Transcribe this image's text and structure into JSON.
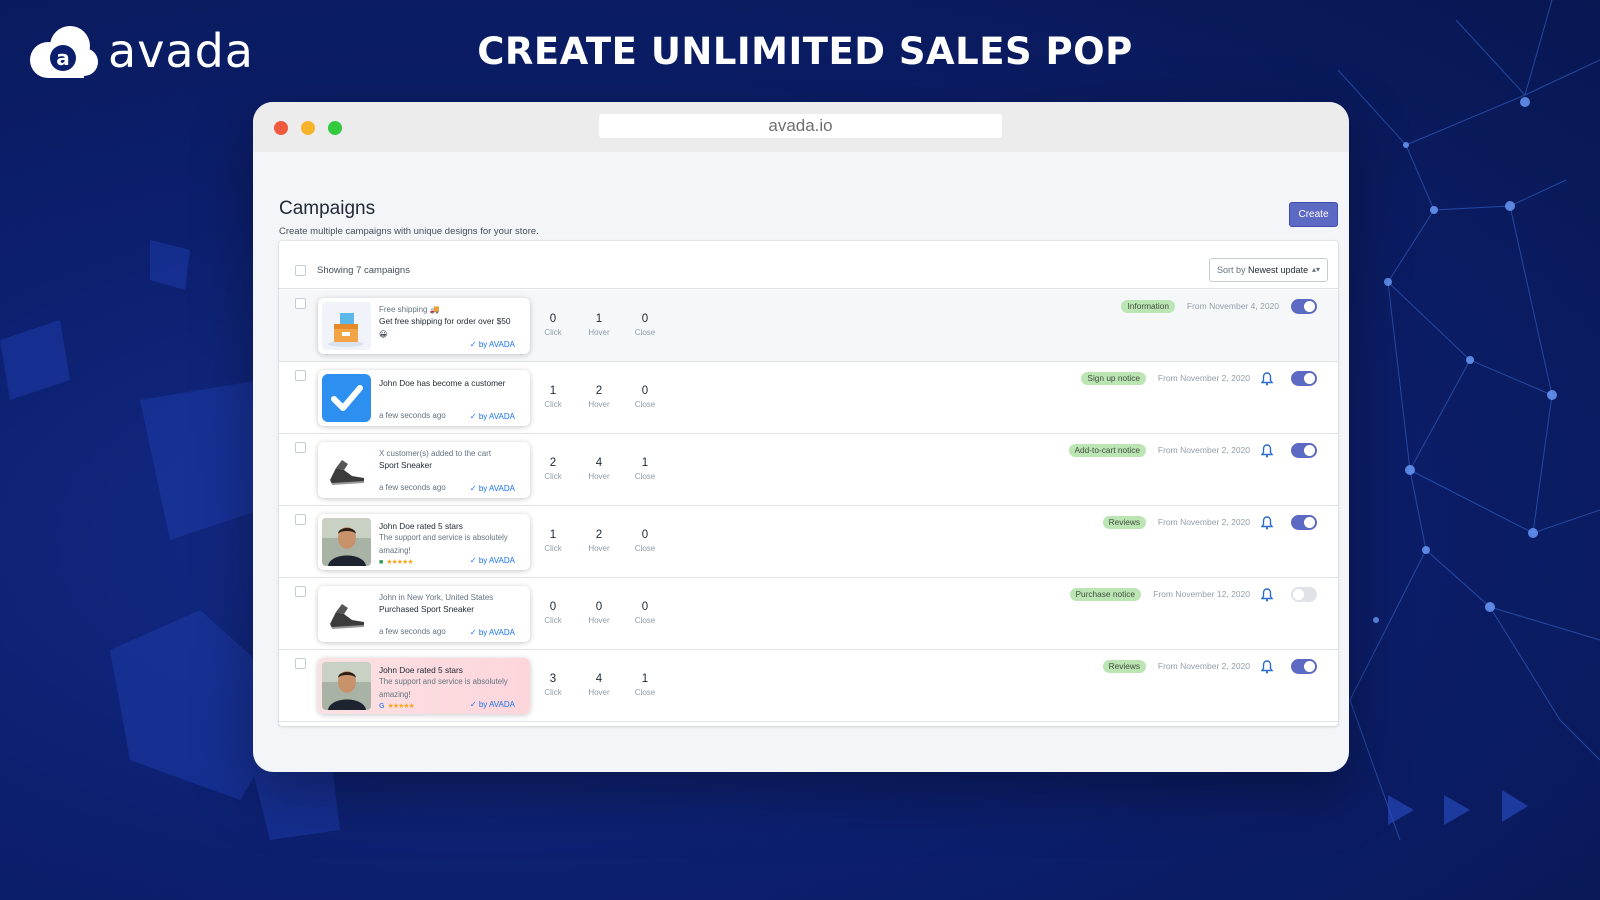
{
  "brand": {
    "name": "avada",
    "logo_icon": "cloud-a-logo-icon"
  },
  "headline": "CREATE UNLIMITED SALES POP",
  "browser": {
    "url": "avada.io"
  },
  "page": {
    "title": "Campaigns",
    "subtitle": "Create multiple campaigns with unique designs for your store.",
    "create_label": "Create"
  },
  "list": {
    "showing": "Showing 7 campaigns",
    "sort_label": "Sort by",
    "sort_value": "Newest update",
    "stat_labels": {
      "click": "Click",
      "hover": "Hover",
      "close": "Close"
    }
  },
  "campaigns": [
    {
      "line1": "Free shipping 🚚",
      "line2": "Get free shipping for order over $50 😀",
      "line3": "",
      "by": "by AVADA",
      "icon": "free-shipping-box-icon",
      "click": "0",
      "hover": "1",
      "close": "0",
      "badge": "Information",
      "from": "From November 4, 2020",
      "bell": false,
      "active": true
    },
    {
      "line1": "",
      "line2": "John Doe has become a customer",
      "line3": "a few seconds ago",
      "by": "by AVADA",
      "icon": "check-square-icon",
      "click": "1",
      "hover": "2",
      "close": "0",
      "badge": "Sign up notice",
      "from": "From November 2, 2020",
      "bell": true,
      "active": true
    },
    {
      "line1": "X customer(s) added to the cart",
      "line2": "Sport Sneaker",
      "line3": "a few seconds ago",
      "by": "by AVADA",
      "icon": "sneaker-icon",
      "click": "2",
      "hover": "4",
      "close": "1",
      "badge": "Add-to-cart notice",
      "from": "From November 2, 2020",
      "bell": true,
      "active": true
    },
    {
      "line1": "John Doe rated 5 stars",
      "line2": "The support and service is absolutely amazing!",
      "stars": "★★★★★",
      "by": "by AVADA",
      "icon": "customer-avatar-icon",
      "click": "1",
      "hover": "2",
      "close": "0",
      "badge": "Reviews",
      "from": "From November 2, 2020",
      "bell": true,
      "active": true
    },
    {
      "line1": "John in New York, United States",
      "line2": "Purchased Sport Sneaker",
      "line3": "a few seconds ago",
      "by": "by AVADA",
      "icon": "sneaker-icon",
      "click": "0",
      "hover": "0",
      "close": "0",
      "badge": "Purchase notice",
      "from": "From November 12, 2020",
      "bell": true,
      "active": false
    },
    {
      "line1": "John Doe rated 5 stars",
      "line2": "The support and service is absolutely amazing!",
      "stars": "★★★★★",
      "google": "G",
      "by": "by AVADA",
      "icon": "customer-avatar-icon",
      "click": "3",
      "hover": "4",
      "close": "1",
      "badge": "Reviews",
      "from": "From November 2, 2020",
      "bell": true,
      "active": true
    }
  ],
  "colors": {
    "primary": "#5c6ac4",
    "badge_bg": "#bbe5b3",
    "link": "#1a73e8",
    "background": "#0c1f6e"
  }
}
